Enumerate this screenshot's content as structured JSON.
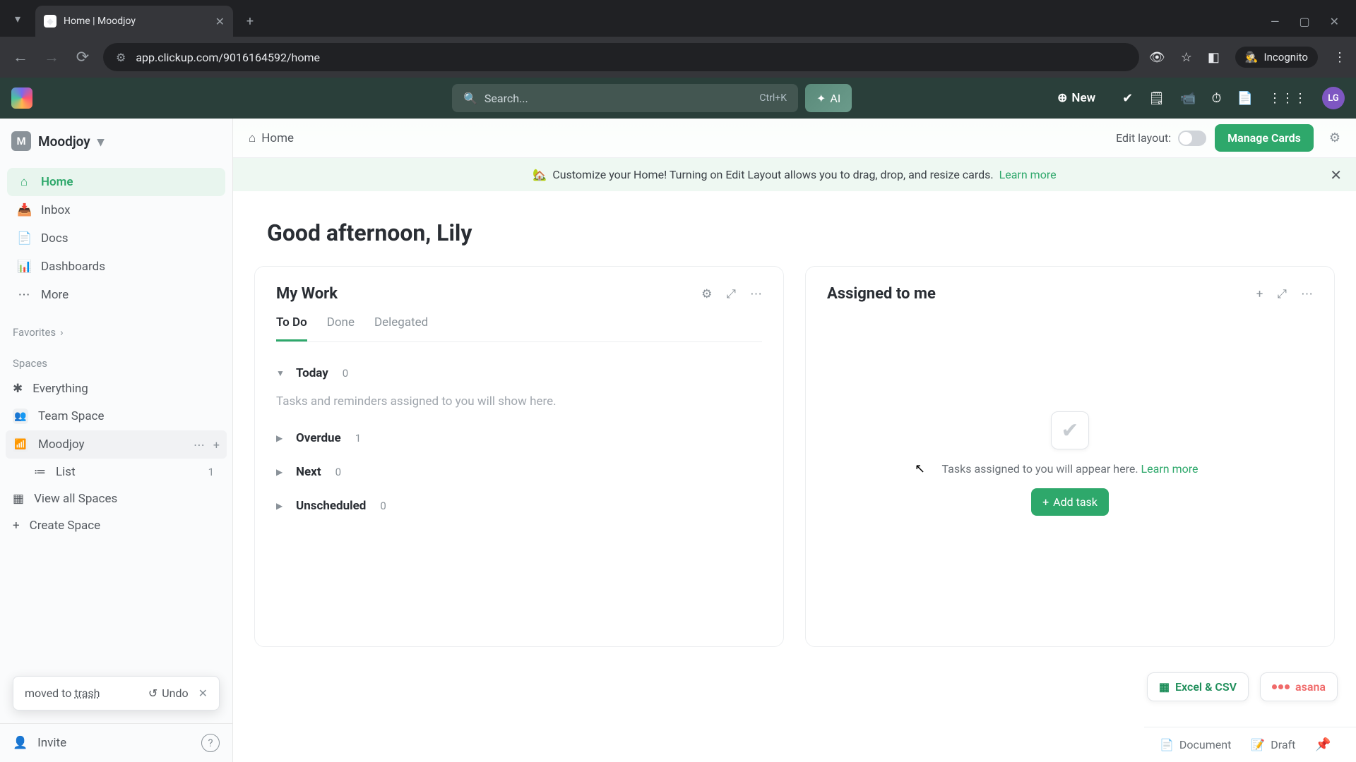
{
  "browser": {
    "tab_title": "Home | Moodjoy",
    "url": "app.clickup.com/9016164592/home",
    "incognito_label": "Incognito"
  },
  "app_top": {
    "search_placeholder": "Search...",
    "search_shortcut": "Ctrl+K",
    "ai_label": "AI",
    "new_label": "New",
    "avatar_initials": "LG"
  },
  "sidebar": {
    "workspace_name": "Moodjoy",
    "workspace_initial": "M",
    "nav": {
      "home": "Home",
      "inbox": "Inbox",
      "docs": "Docs",
      "dashboards": "Dashboards",
      "more": "More"
    },
    "favorites_label": "Favorites",
    "spaces_label": "Spaces",
    "everything_label": "Everything",
    "team_space_label": "Team Space",
    "moodjoy_space_label": "Moodjoy",
    "list_label": "List",
    "list_count": "1",
    "view_all_spaces": "View all Spaces",
    "create_space": "Create Space",
    "toast_prefix": "moved to ",
    "toast_trash": "trash",
    "toast_undo": "Undo",
    "invite_label": "Invite"
  },
  "header": {
    "breadcrumb_home": "Home",
    "edit_layout_label": "Edit layout:",
    "manage_cards": "Manage Cards"
  },
  "banner": {
    "emoji": "🏡",
    "text": "Customize your Home! Turning on Edit Layout allows you to drag, drop, and resize cards.",
    "learn_more": "Learn more"
  },
  "greeting": "Good afternoon, Lily",
  "my_work": {
    "title": "My Work",
    "tabs": {
      "todo": "To Do",
      "done": "Done",
      "delegated": "Delegated"
    },
    "groups": {
      "today": {
        "name": "Today",
        "count": "0"
      },
      "overdue": {
        "name": "Overdue",
        "count": "1"
      },
      "next": {
        "name": "Next",
        "count": "0"
      },
      "unscheduled": {
        "name": "Unscheduled",
        "count": "0"
      }
    },
    "empty_today": "Tasks and reminders assigned to you will show here."
  },
  "assigned": {
    "title": "Assigned to me",
    "empty_text": "Tasks assigned to you will appear here.",
    "learn_more": "Learn more",
    "add_task": "Add task"
  },
  "integrations": {
    "excel": "Excel & CSV",
    "asana": "asana"
  },
  "bottom": {
    "document": "Document",
    "draft": "Draft"
  }
}
